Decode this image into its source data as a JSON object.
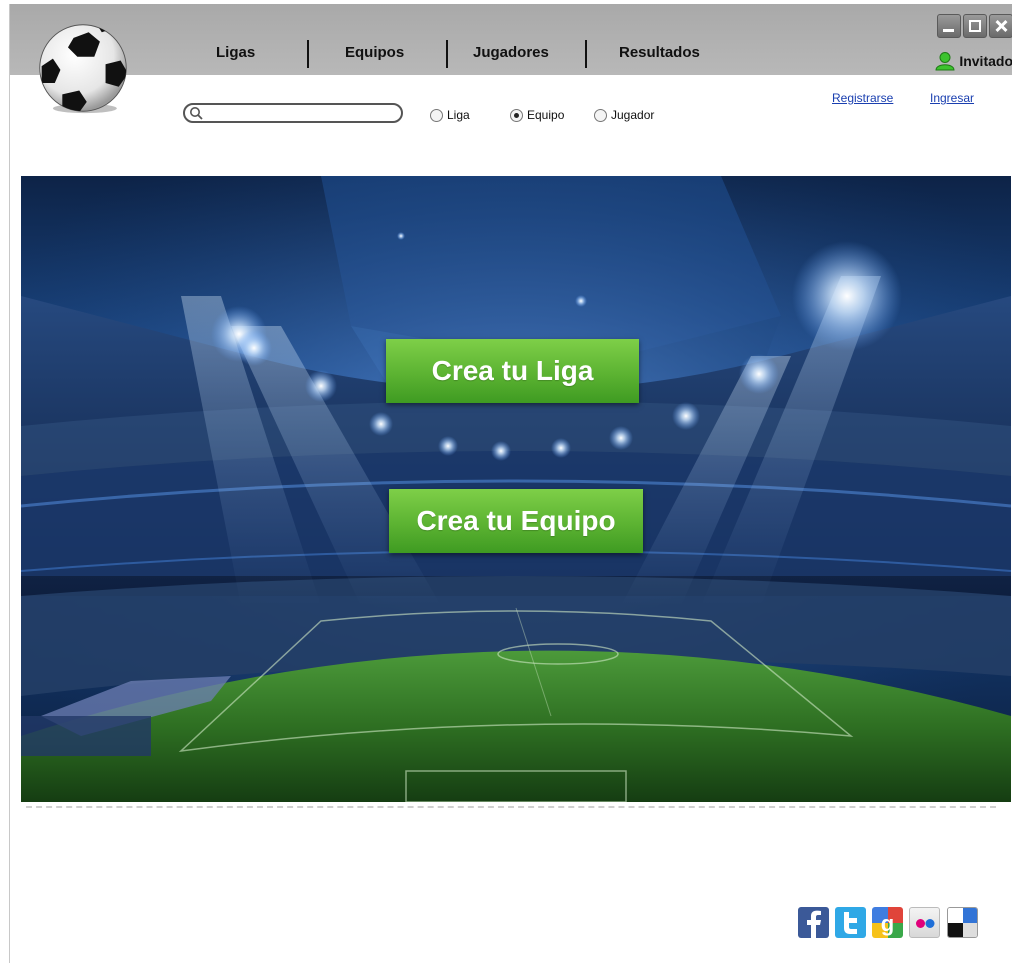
{
  "nav": {
    "items": [
      "Ligas",
      "Equipos",
      "Jugadores",
      "Resultados"
    ]
  },
  "user": {
    "name": "Invitado"
  },
  "search": {
    "value": ""
  },
  "filters": {
    "options": [
      "Liga",
      "Equipo",
      "Jugador"
    ],
    "selected": "Equipo"
  },
  "account_links": {
    "register": "Registrarse",
    "login": "Ingresar"
  },
  "hero": {
    "cta_league": "Crea tu Liga",
    "cta_team": "Crea tu Equipo"
  },
  "social_icons": [
    "facebook-icon",
    "twitter-icon",
    "google-icon",
    "flickr-icon",
    "delicious-icon"
  ],
  "colors": {
    "titlebar": "#b0b0b0",
    "cta_green": "#5cb332",
    "link_blue": "#1a3fb0",
    "user_icon_green": "#3cc32e"
  }
}
